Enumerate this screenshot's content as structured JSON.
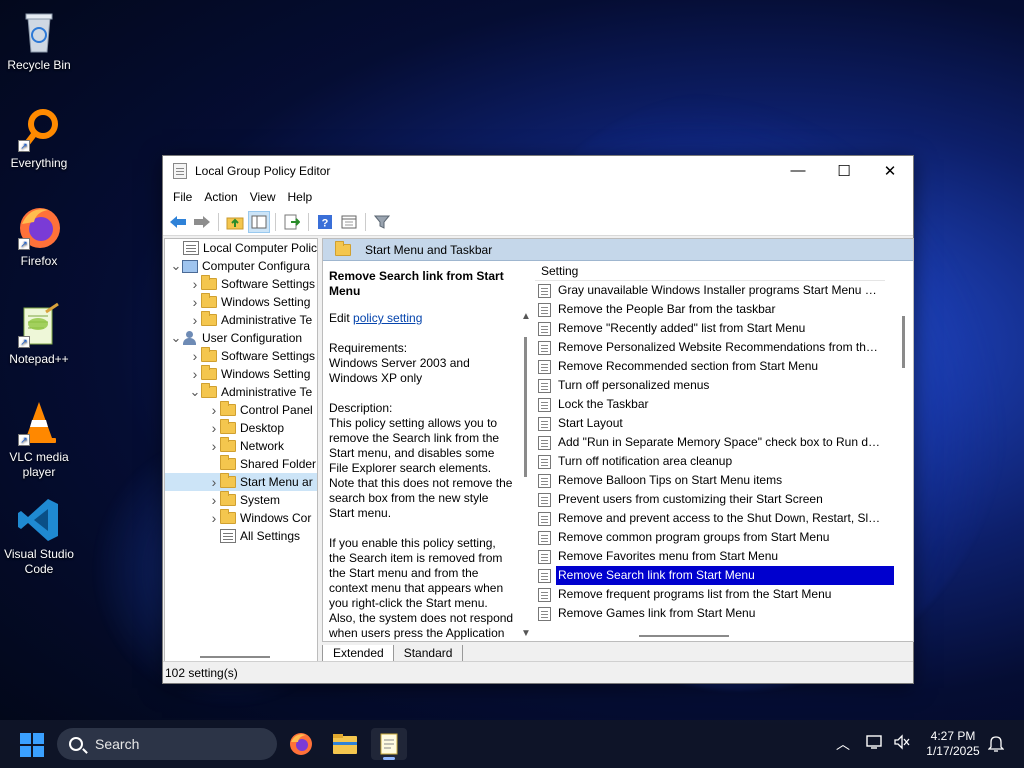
{
  "desktop": {
    "icons": [
      {
        "label": "Recycle Bin",
        "icon": "recycle-bin-icon"
      },
      {
        "label": "Everything",
        "icon": "everything-search-icon"
      },
      {
        "label": "Firefox",
        "icon": "firefox-icon"
      },
      {
        "label": "Notepad++",
        "icon": "notepad-plus-plus-icon"
      },
      {
        "label": "VLC media player",
        "icon": "vlc-cone-icon"
      },
      {
        "label": "Visual Studio Code",
        "icon": "vscode-icon"
      }
    ]
  },
  "window": {
    "title": "Local Group Policy Editor",
    "controls": {
      "minimize": "—",
      "maximize": "☐",
      "close": "✕"
    },
    "menu": [
      "File",
      "Action",
      "View",
      "Help"
    ],
    "toolbar_icons": [
      "back-arrow-icon",
      "forward-arrow-icon",
      "up-folder-icon",
      "show-hide-tree-icon",
      "export-list-icon",
      "help-icon",
      "properties-icon",
      "filter-icon"
    ],
    "tree": [
      {
        "label": "Local Computer Policy",
        "indent": 0,
        "toggle": "",
        "icon": "policy"
      },
      {
        "label": "Computer Configura",
        "indent": 1,
        "toggle": "v",
        "icon": "pc"
      },
      {
        "label": "Software Settings",
        "indent": 2,
        "toggle": ">",
        "icon": "folder"
      },
      {
        "label": "Windows Setting",
        "indent": 2,
        "toggle": ">",
        "icon": "folder"
      },
      {
        "label": "Administrative Te",
        "indent": 2,
        "toggle": ">",
        "icon": "folder"
      },
      {
        "label": "User Configuration",
        "indent": 1,
        "toggle": "v",
        "icon": "user"
      },
      {
        "label": "Software Settings",
        "indent": 2,
        "toggle": ">",
        "icon": "folder"
      },
      {
        "label": "Windows Setting",
        "indent": 2,
        "toggle": ">",
        "icon": "folder"
      },
      {
        "label": "Administrative Te",
        "indent": 2,
        "toggle": "v",
        "icon": "folder"
      },
      {
        "label": "Control Panel",
        "indent": 3,
        "toggle": ">",
        "icon": "folder"
      },
      {
        "label": "Desktop",
        "indent": 3,
        "toggle": ">",
        "icon": "folder"
      },
      {
        "label": "Network",
        "indent": 3,
        "toggle": ">",
        "icon": "folder"
      },
      {
        "label": "Shared Folder",
        "indent": 3,
        "toggle": "",
        "icon": "folder"
      },
      {
        "label": "Start Menu ar",
        "indent": 3,
        "toggle": ">",
        "icon": "folder",
        "selected": true
      },
      {
        "label": "System",
        "indent": 3,
        "toggle": ">",
        "icon": "folder"
      },
      {
        "label": "Windows Cor",
        "indent": 3,
        "toggle": ">",
        "icon": "folder"
      },
      {
        "label": "All Settings",
        "indent": 3,
        "toggle": "",
        "icon": "allsettings"
      }
    ],
    "right_header": "Start Menu and Taskbar",
    "description": {
      "title": "Remove Search link from Start Menu",
      "edit_prefix": "Edit",
      "edit_link": "policy setting",
      "requirements": "Requirements:\nWindows Server 2003 and Windows XP only",
      "description": "Description:\nThis policy setting allows you to remove the Search link from the Start menu, and disables some File Explorer search elements.  Note that this does not remove the search box from the new style Start menu.",
      "more": "If you enable this policy setting, the Search item is removed from the Start menu and from the context menu that appears when you right-click the Start menu. Also, the system does not respond when users press the Application"
    },
    "list": {
      "column_header": "Setting",
      "rows": [
        "Gray unavailable Windows Installer programs Start Menu sh...",
        "Remove the People Bar from the taskbar",
        "Remove \"Recently added\" list from Start Menu",
        "Remove Personalized Website Recommendations from the ...",
        "Remove Recommended section from Start Menu",
        "Turn off personalized menus",
        "Lock the Taskbar",
        "Start Layout",
        "Add \"Run in Separate Memory Space\" check box to Run dial...",
        "Turn off notification area cleanup",
        "Remove Balloon Tips on Start Menu items",
        "Prevent users from customizing their Start Screen",
        "Remove and prevent access to the Shut Down, Restart, Sleep...",
        "Remove common program groups from Start Menu",
        "Remove Favorites menu from Start Menu",
        "Remove Search link from Start Menu",
        "Remove frequent programs list from the Start Menu",
        "Remove Games link from Start Menu"
      ],
      "selected_index": 15
    },
    "tabs": [
      "Extended",
      "Standard"
    ],
    "active_tab": "Extended",
    "status": "102 setting(s)"
  },
  "taskbar": {
    "search_placeholder": "Search",
    "apps": [
      "firefox-icon",
      "file-explorer-icon",
      "notepad-icon"
    ],
    "tray_icons": [
      "chevron-up-icon",
      "network-icon",
      "volume-muted-icon",
      "bell-icon"
    ],
    "time": "4:27 PM",
    "date": "1/17/2025"
  },
  "colors": {
    "selection": "#0000ce",
    "header_band": "#c5d7ea",
    "link": "#0645ad"
  }
}
